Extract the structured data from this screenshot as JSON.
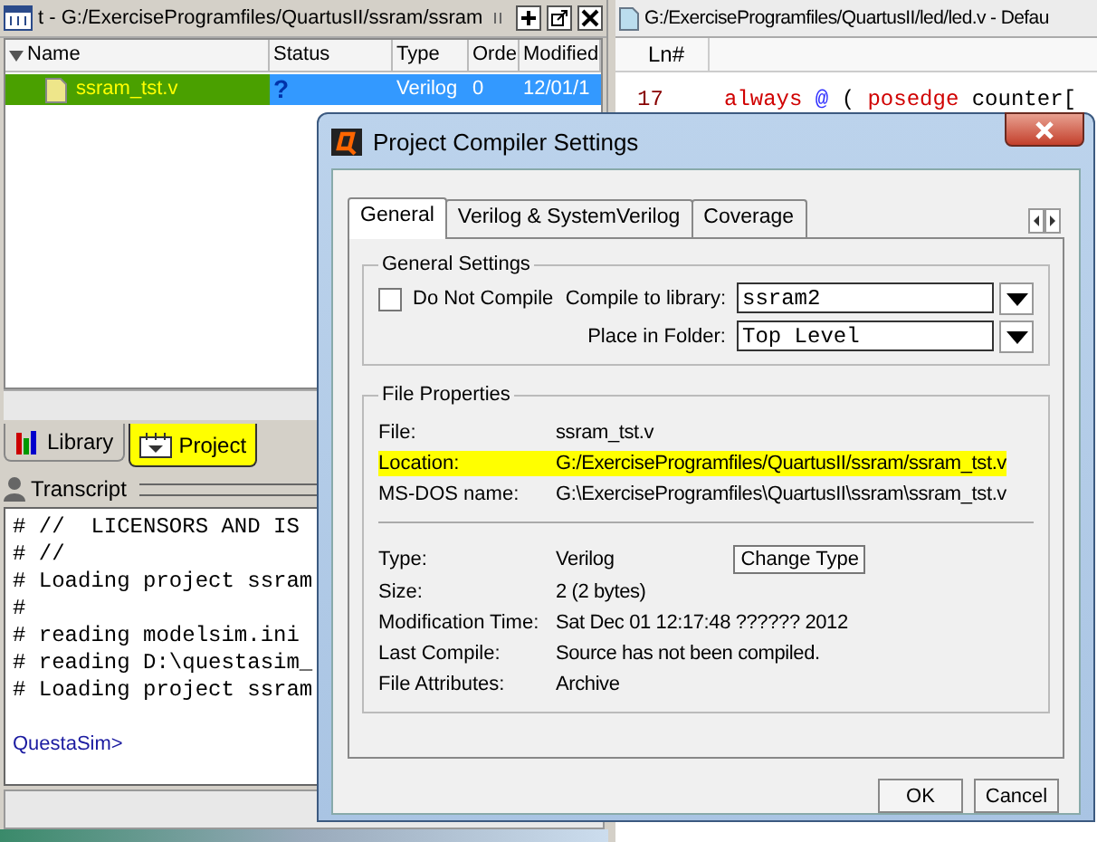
{
  "project_pane": {
    "title": "t - G:/ExerciseProgramfiles/QuartusII/ssram/ssram",
    "columns": [
      "Name",
      "Status",
      "Type",
      "Orde",
      "Modified"
    ],
    "rows": [
      {
        "name": "ssram_tst.v",
        "status": "?",
        "type": "Verilog",
        "order": "0",
        "modified": "12/01/1",
        "selected": true,
        "highlighted": true
      }
    ]
  },
  "tabs": [
    {
      "label": "Library",
      "selected": false,
      "highlighted": false
    },
    {
      "label": "Project",
      "selected": true,
      "highlighted": true
    }
  ],
  "transcript": {
    "title": "Transcript",
    "lines": [
      "# //  LICENSORS AND IS",
      "# //",
      "# Loading project ssram",
      "#",
      "# reading modelsim.ini",
      "# reading D:\\questasim_",
      "# Loading project ssram"
    ],
    "prompt": "QuestaSim>"
  },
  "editor": {
    "title": "G:/ExerciseProgramfiles/QuartusII/led/led.v - Defau",
    "gutter_heading": "Ln#",
    "lines": [
      {
        "number": "17",
        "tokens": [
          {
            "kind": "keyword",
            "text": "always"
          },
          {
            "kind": "operator",
            "text": "@"
          },
          {
            "kind": "plain",
            "text": "("
          },
          {
            "kind": "keyword",
            "text": "posedge"
          },
          {
            "kind": "plain",
            "text": "counter["
          }
        ]
      }
    ]
  },
  "dialog": {
    "title": "Project Compiler Settings",
    "tabs": [
      {
        "label": "General",
        "selected": true
      },
      {
        "label": "Verilog & SystemVerilog",
        "selected": false
      },
      {
        "label": "Coverage",
        "selected": false
      }
    ],
    "general_settings": {
      "title": "General Settings",
      "do_not_compile": {
        "label": "Do Not Compile",
        "checked": false
      },
      "compile_to_library": {
        "label": "Compile to library:",
        "value": "ssram2"
      },
      "place_in_folder": {
        "label": "Place in Folder:",
        "value": "Top Level"
      }
    },
    "file_properties": {
      "title": "File Properties",
      "groups": [
        [
          {
            "label": "File:",
            "value": "ssram_tst.v",
            "highlighted": false
          },
          {
            "label": "Location:",
            "value": "G:/ExerciseProgramfiles/QuartusII/ssram/ssram_tst.v",
            "highlighted": true
          },
          {
            "label": "MS-DOS name:",
            "value": "G:\\ExerciseProgramfiles\\QuartusII\\ssram\\ssram_tst.v",
            "highlighted": false
          }
        ],
        [
          {
            "label": "Type:",
            "value": "Verilog",
            "highlighted": false,
            "button": "Change Type"
          },
          {
            "label": "Size:",
            "value": "2 (2 bytes)",
            "highlighted": false
          },
          {
            "label": "Modification Time:",
            "value": "Sat Dec 01 12:17:48 ?????? 2012",
            "highlighted": false
          },
          {
            "label": "Last Compile:",
            "value": "Source has not been compiled.",
            "highlighted": false
          },
          {
            "label": "File Attributes:",
            "value": "Archive",
            "highlighted": false
          }
        ]
      ]
    },
    "buttons": [
      "OK",
      "Cancel"
    ]
  }
}
